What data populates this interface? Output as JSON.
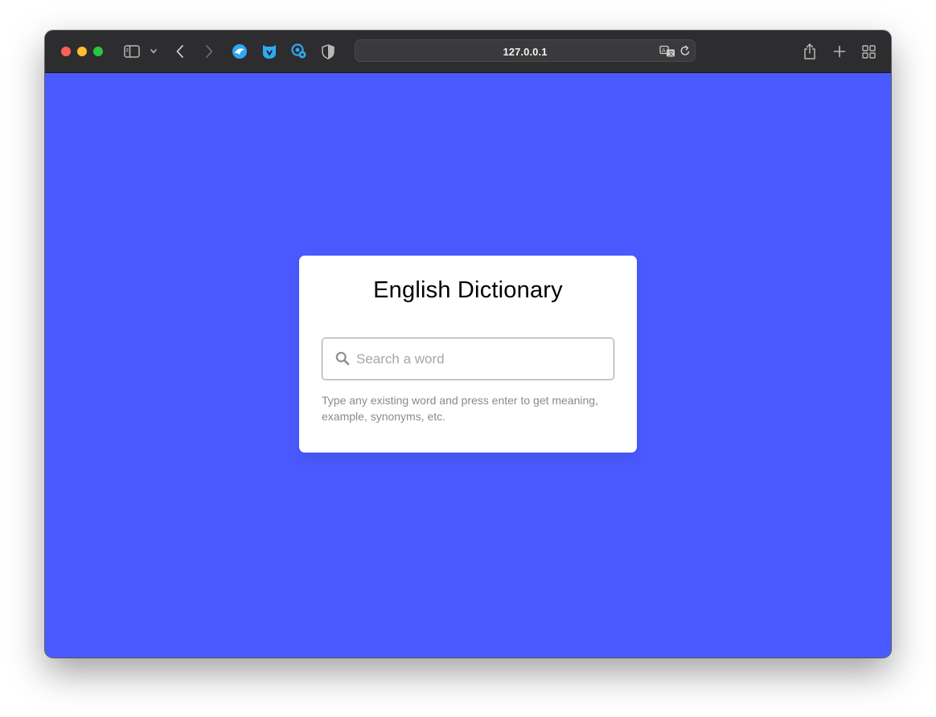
{
  "browser": {
    "url": "127.0.0.1",
    "colors": {
      "toolbar": "#2d2d2f",
      "close": "#fe5f57",
      "minimize": "#febc2e",
      "maximize": "#28c840",
      "extension_accent": "#2ea9f0"
    }
  },
  "page": {
    "background": "#4a5aff",
    "card": {
      "title": "English Dictionary",
      "search_placeholder": "Search a word",
      "search_value": "",
      "hint": "Type any existing word and press enter to get meaning, example, synonyms, etc."
    }
  }
}
